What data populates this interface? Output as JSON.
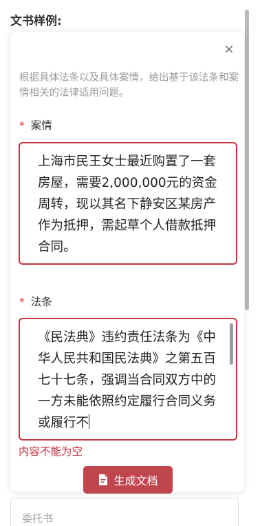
{
  "section": {
    "title": "文书样例:"
  },
  "panel": {
    "close_icon": "×",
    "hint": "根据具体法条以及具体案情，给出基于该法条和案情相关的法律适用问题。",
    "case_field": {
      "required_mark": "*",
      "label": "案情",
      "value": "上海市民王女士最近购置了一套房屋，需要2,000,000元的资金周转，现以其名下静安区某房产作为抵押，需起草个人借款抵押合同。"
    },
    "law_field": {
      "required_mark": "*",
      "label": "法条",
      "value": "《民法典》违约责任法条为《中华人民共和国民法典》之第五百七十七条，强调当合同双方中的一方未能依照约定履行合同义务或履行不"
    },
    "error_text": "内容不能为空",
    "generate_button": {
      "label": "生成文档",
      "icon": "document-icon"
    }
  },
  "next_field": {
    "placeholder": "委托书"
  },
  "colors": {
    "accent": "#c4343e",
    "button": "#c0454d",
    "hint": "#9b9b9b"
  }
}
